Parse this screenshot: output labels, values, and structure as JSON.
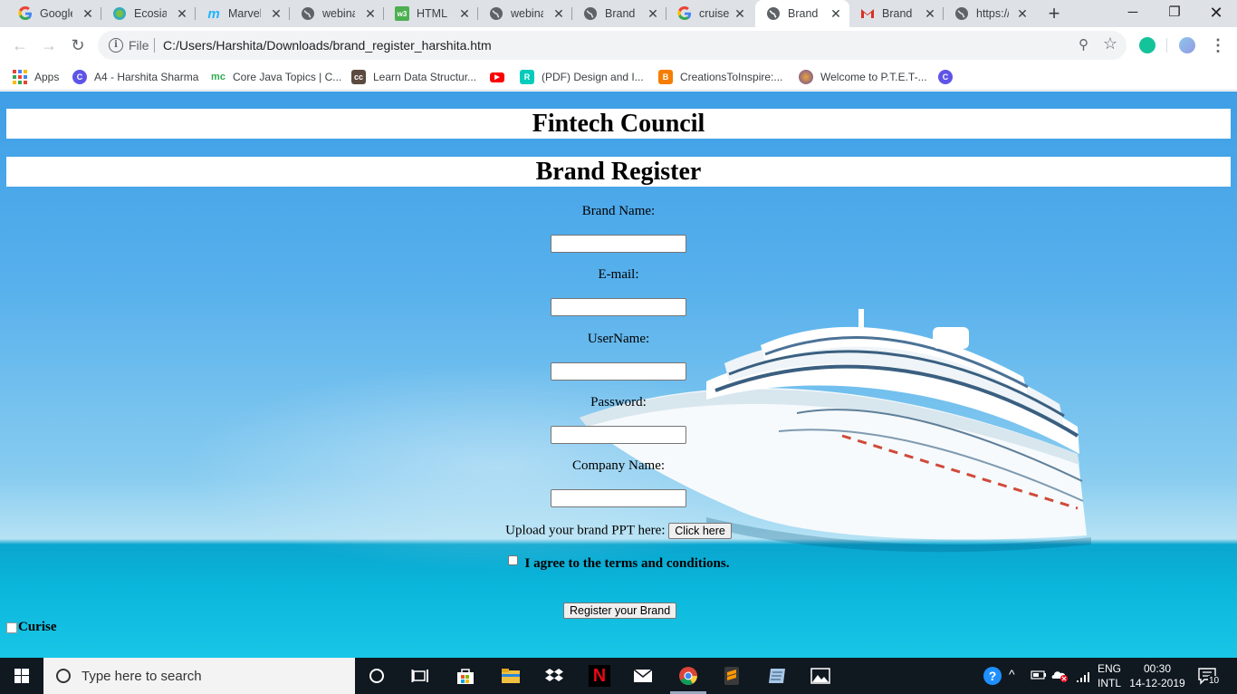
{
  "browser": {
    "tabs": [
      {
        "title": "Google",
        "icon": "google-icon",
        "active": false
      },
      {
        "title": "Ecosia",
        "icon": "ecosia-icon",
        "active": false
      },
      {
        "title": "Marvel",
        "icon": "marvel-icon",
        "active": false
      },
      {
        "title": "webina",
        "icon": "globe-icon",
        "active": false
      },
      {
        "title": "HTML T",
        "icon": "w3-icon",
        "active": false
      },
      {
        "title": "webina",
        "icon": "globe-icon",
        "active": false
      },
      {
        "title": "Brand R",
        "icon": "globe-icon",
        "active": false
      },
      {
        "title": "cruise i",
        "icon": "google-icon",
        "active": false
      },
      {
        "title": "Brand R",
        "icon": "globe-icon",
        "active": true
      },
      {
        "title": "Brand E",
        "icon": "gmail-icon",
        "active": false
      },
      {
        "title": "https://",
        "icon": "globe-icon",
        "active": false
      }
    ],
    "address": {
      "scheme_label": "File",
      "url": "C:/Users/Harshita/Downloads/brand_register_harshita.htm"
    },
    "bookmarks": [
      {
        "label": "Apps",
        "icon": "apps-grid-icon"
      },
      {
        "label": "A4 - Harshita Sharma",
        "icon": "canva-icon"
      },
      {
        "label": "Core Java Topics | C...",
        "icon": "mc-icon"
      },
      {
        "label": "Learn Data Structur...",
        "icon": "cc-icon"
      },
      {
        "label": "",
        "icon": "youtube-icon"
      },
      {
        "label": "(PDF) Design and I...",
        "icon": "researchgate-icon"
      },
      {
        "label": "CreationsToInspire:...",
        "icon": "blogger-icon"
      },
      {
        "label": "Welcome to P.T.E.T-...",
        "icon": "emblem-icon"
      },
      {
        "label": "",
        "icon": "canva-icon"
      }
    ]
  },
  "page": {
    "heading": "Fintech Council",
    "subheading": "Brand Register",
    "fields": {
      "brand_name": {
        "label": "Brand Name:",
        "value": ""
      },
      "email": {
        "label": "E-mail:",
        "value": ""
      },
      "username": {
        "label": "UserName:",
        "value": ""
      },
      "password": {
        "label": "Password:",
        "value": ""
      },
      "company_name": {
        "label": "Company Name:",
        "value": ""
      }
    },
    "upload_label": "Upload your brand PPT here:",
    "upload_button": "Click here",
    "terms_label": "I agree to the terms and conditions.",
    "terms_checked": false,
    "register_button": "Register your Brand",
    "broken_image_alt": "Curise"
  },
  "taskbar": {
    "search_placeholder": "Type here to search",
    "apps": [
      "cortana-icon",
      "task-view-icon",
      "store-icon",
      "file-explorer-icon",
      "dropbox-icon",
      "netflix-icon",
      "mail-icon",
      "chrome-icon",
      "sublime-icon",
      "notepad-icon",
      "photos-icon"
    ],
    "language_top": "ENG",
    "language_bottom": "INTL",
    "time": "00:30",
    "date": "14-12-2019",
    "notification_count": "10"
  },
  "colors": {
    "tabstrip": "#dee1e6",
    "taskbar": "#101820",
    "sky": "#3e9ee6",
    "sea": "#0bb7dc"
  }
}
